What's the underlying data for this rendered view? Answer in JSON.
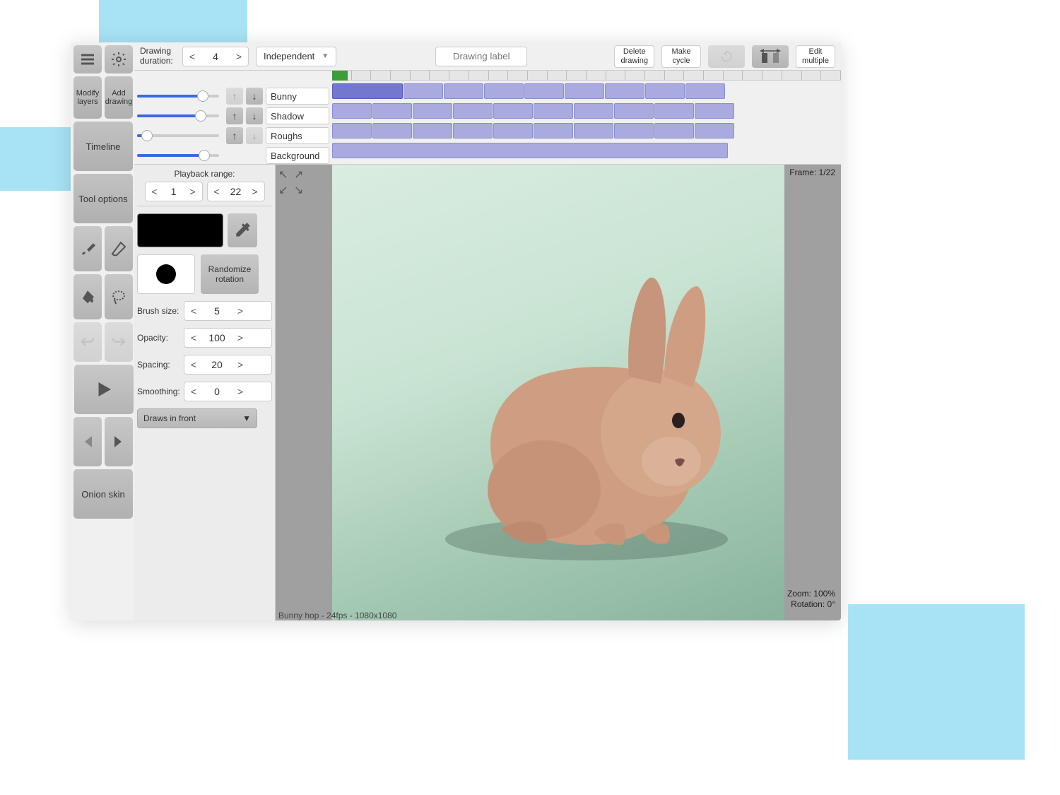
{
  "topbar": {
    "drawing_duration_label": "Drawing\nduration:",
    "drawing_duration": 4,
    "mode": "Independent",
    "drawing_label_placeholder": "Drawing label",
    "delete_drawing": "Delete\ndrawing",
    "make_cycle": "Make\ncycle",
    "edit_multiple": "Edit\nmultiple"
  },
  "sidebar": {
    "modify_layers": "Modify\nlayers",
    "add_drawing": "Add\ndrawing",
    "timeline": "Timeline",
    "tool_options": "Tool options",
    "onion_skin": "Onion skin"
  },
  "layers": [
    {
      "name": "Bunny",
      "opacity": 80,
      "up_disabled": true,
      "down_disabled": false
    },
    {
      "name": "Shadow",
      "opacity": 78,
      "up_disabled": false,
      "down_disabled": false
    },
    {
      "name": "Roughs",
      "opacity": 12,
      "up_disabled": false,
      "down_disabled": true
    },
    {
      "name": "Background",
      "opacity": 82,
      "up_disabled": true,
      "down_disabled": true
    }
  ],
  "playback": {
    "label": "Playback range:",
    "start": 1,
    "end": 22
  },
  "tool": {
    "current_color": "#000000",
    "randomize_rotation": "Randomize\nrotation",
    "brush_size_label": "Brush size:",
    "brush_size": 5,
    "opacity_label": "Opacity:",
    "opacity": 100,
    "spacing_label": "Spacing:",
    "spacing": 20,
    "smoothing_label": "Smoothing:",
    "smoothing": 0,
    "draws_in_front": "Draws in front"
  },
  "canvas": {
    "frame_label": "Frame: 1/22",
    "zoom_label": "Zoom: 100%",
    "rotation_label": "Rotation: 0°",
    "project_info": "Bunny hop - 24fps - 1080x1080"
  }
}
